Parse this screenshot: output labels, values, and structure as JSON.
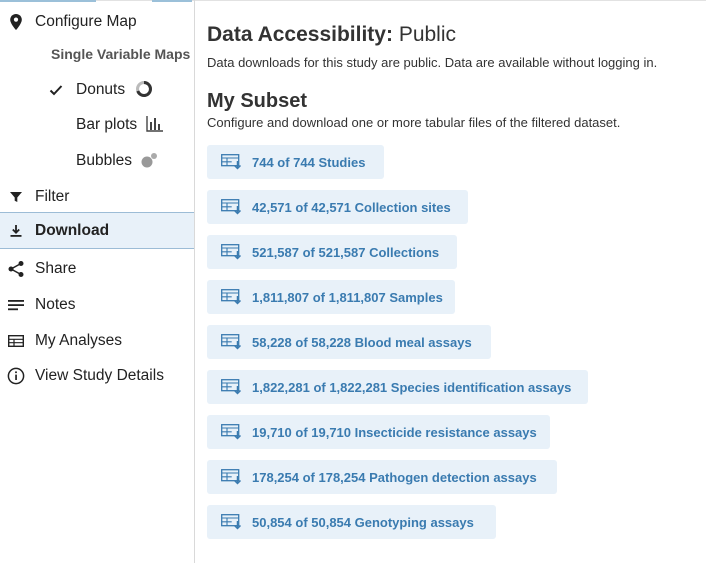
{
  "sidebar": {
    "configure_map": "Configure Map",
    "section_label": "Single Variable Maps",
    "sub_items": [
      {
        "label": "Donuts",
        "icon": "donut-chart-icon",
        "checked": true
      },
      {
        "label": "Bar plots",
        "icon": "bar-chart-icon",
        "checked": false
      },
      {
        "label": "Bubbles",
        "icon": "bubbles-icon",
        "checked": false
      }
    ],
    "items": [
      {
        "label": "Filter",
        "icon": "filter-icon"
      },
      {
        "label": "Download",
        "icon": "download-icon",
        "active": true
      },
      {
        "label": "Share",
        "icon": "share-icon"
      },
      {
        "label": "Notes",
        "icon": "notes-icon"
      },
      {
        "label": "My Analyses",
        "icon": "table-icon"
      },
      {
        "label": "View Study Details",
        "icon": "info-icon"
      }
    ]
  },
  "main": {
    "accessibility_label": "Data Accessibility:",
    "accessibility_value": "Public",
    "accessibility_desc": "Data downloads for this study are public. Data are available without logging in.",
    "subset_title": "My Subset",
    "subset_desc": "Configure and download one or more tabular files of the filtered dataset.",
    "downloads": [
      "744 of 744 Studies",
      "42,571 of 42,571 Collection sites",
      "521,587 of 521,587 Collections",
      "1,811,807 of 1,811,807 Samples",
      "58,228 of 58,228 Blood meal assays",
      "1,822,281 of 1,822,281 Species identification assays",
      "19,710 of 19,710 Insecticide resistance assays",
      "178,254 of 178,254 Pathogen detection assays",
      "50,854 of 50,854 Genotyping assays"
    ]
  },
  "colors": {
    "accent": "#3a7bb0",
    "button_bg": "#e8f1f9",
    "active_border": "#9cbcd6"
  }
}
